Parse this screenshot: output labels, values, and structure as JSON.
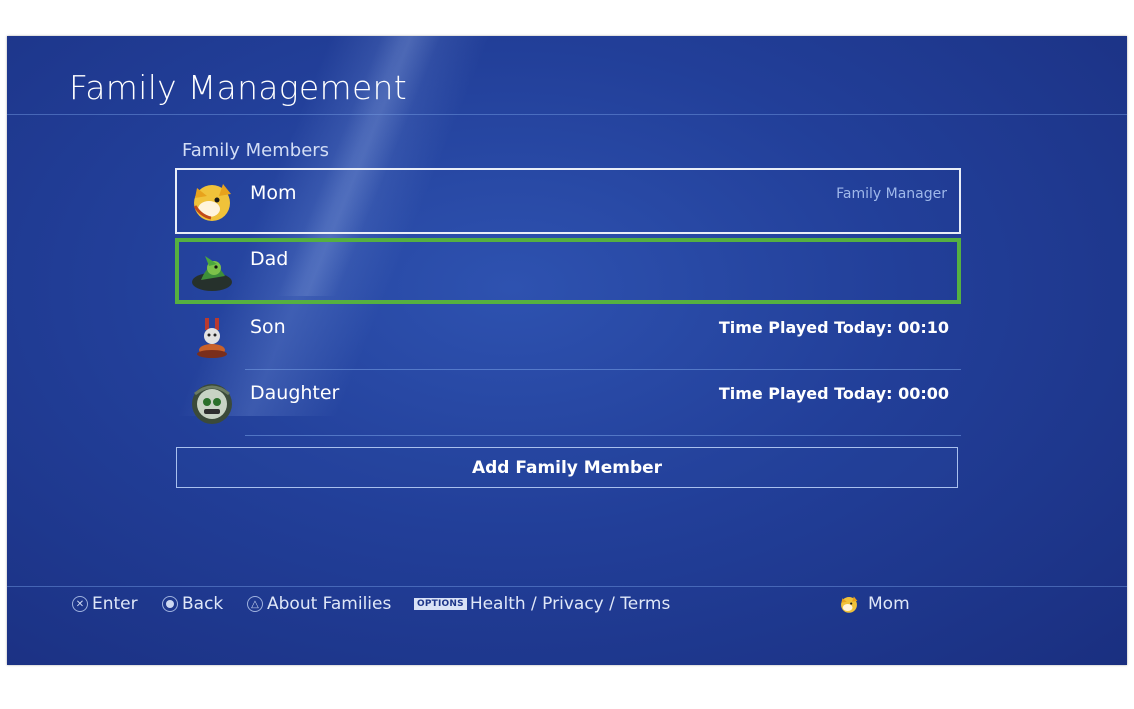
{
  "header": {
    "title": "Family Management"
  },
  "members_section": {
    "label": "Family Members"
  },
  "members": [
    {
      "name": "Mom",
      "right_text": "Family Manager",
      "avatar": "fox-avatar-icon",
      "state": "selected"
    },
    {
      "name": "Dad",
      "right_text": "",
      "avatar": "green-warrior-avatar-icon",
      "state": "focused"
    },
    {
      "name": "Son",
      "right_text": "Time Played Today: 00:10",
      "avatar": "robot-avatar-icon",
      "state": "normal"
    },
    {
      "name": "Daughter",
      "right_text": "Time Played Today: 00:00",
      "avatar": "masked-avatar-icon",
      "state": "normal"
    }
  ],
  "add_button": {
    "label": "Add Family Member"
  },
  "footer": {
    "enter": {
      "icon": "cross-button-icon",
      "label": "Enter"
    },
    "back": {
      "icon": "circle-button-icon",
      "label": "Back"
    },
    "about": {
      "icon": "triangle-button-icon",
      "label": "About Families"
    },
    "options": {
      "badge": "OPTIONS",
      "label": "Health / Privacy / Terms"
    },
    "user": {
      "icon": "fox-avatar-icon",
      "label": "Mom"
    }
  },
  "colors": {
    "background": "#223f99",
    "focus_border": "#55b041",
    "selected_border": "#e9eef8",
    "text": "#ffffff"
  }
}
